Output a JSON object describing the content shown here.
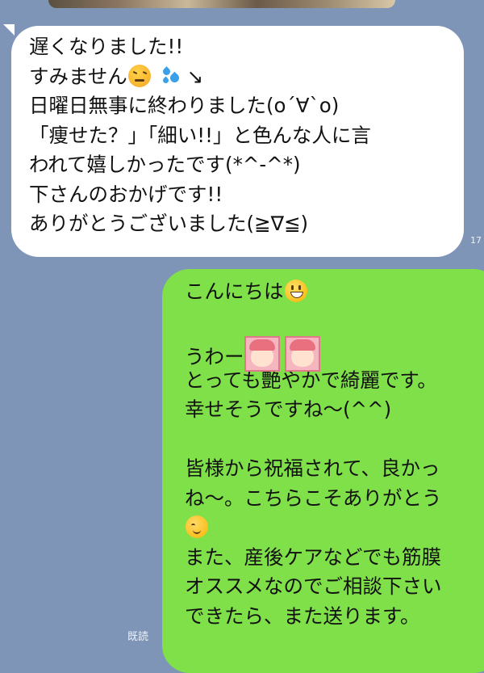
{
  "chat": {
    "incoming": {
      "lines": [
        "遅くなりました!!",
        "すみません",
        "↘",
        "日曜日無事に終わりました(o´∀`o)",
        "「痩せた？」「細い!!」と色んな人に言",
        "われて嬉しかったです(*^-^*)",
        "下さんのおかげです!!",
        "ありがとうございました(≧∇≦)"
      ],
      "time": "17"
    },
    "outgoing": {
      "lines": [
        "こんにちは",
        "うわー",
        "とっても艶やかで綺麗です。",
        "幸せそうですね～(^^)",
        "皆様から祝福されて、良かっ",
        "ね～。こちらこそありがとう",
        "また、産後ケアなどでも筋膜",
        "オススメなのでご相談下さい",
        "できたら、また送ります。"
      ],
      "read_label": "既読"
    }
  },
  "icons": [
    "confounded-face-icon",
    "sweat-droplets-icon",
    "grinning-face-icon",
    "girl-sticker-icon",
    "smiling-face-icon"
  ],
  "colors": {
    "background": "#7e95b8",
    "incoming_bubble": "#ffffff",
    "outgoing_bubble": "#7fe04a"
  }
}
